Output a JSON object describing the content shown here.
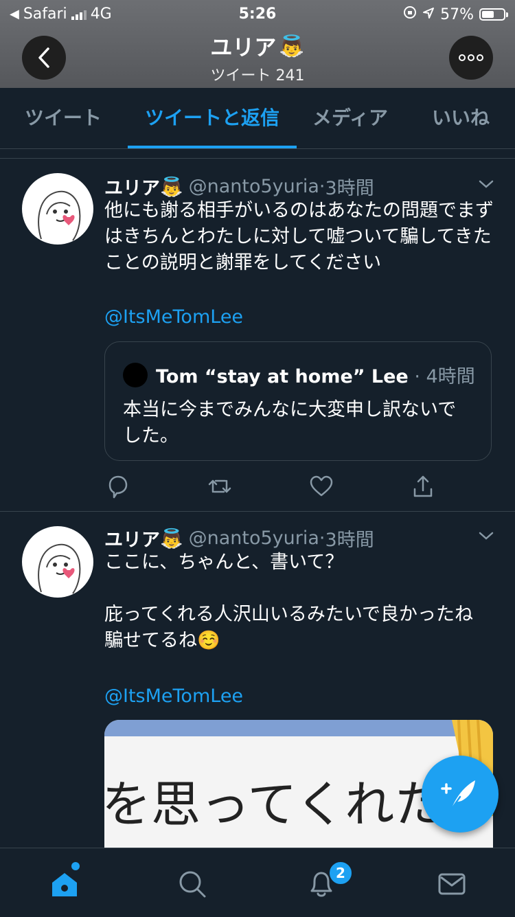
{
  "status_bar": {
    "back_app": "Safari",
    "network": "4G",
    "time": "5:26",
    "battery_percent_label": "57%",
    "battery_level": 0.57
  },
  "profile_header": {
    "name": "ユリア",
    "name_emoji": "👼",
    "tweet_count_label": "ツイート 241"
  },
  "tabs": [
    {
      "label": "ツイート",
      "active": false
    },
    {
      "label": "ツイートと返信",
      "active": true
    },
    {
      "label": "メディア",
      "active": false
    },
    {
      "label": "いいね",
      "active": false
    }
  ],
  "tweets": [
    {
      "author": "ユリア",
      "author_emoji": "👼",
      "handle": "@nanto5yuria",
      "time": "3時間",
      "text": "他にも謝る相手がいるのはあなたの問題でまずはきちんとわたしに対して嘘ついて騙してきたことの説明と謝罪をしてください",
      "mention": "@ItsMeTomLee",
      "quote": {
        "author": "Tom “stay at home” Lee",
        "time": "4時間",
        "text": "本当に今までみんなに大変申し訳ないでした。"
      }
    },
    {
      "author": "ユリア",
      "author_emoji": "👼",
      "handle": "@nanto5yuria",
      "time": "3時間",
      "text": "ここに、ちゃんと、書いて？\n\n庇ってくれる人沢山いるみたいで良かったね\n騙せてるね☺️",
      "mention": "@ItsMeTomLee",
      "media_text": "を思ってくれた"
    }
  ],
  "bottom_nav": {
    "notifications_badge": "2"
  },
  "colors": {
    "background": "#15202b",
    "accent": "#1da1f2",
    "secondary_text": "#8899a6",
    "divider": "#38444d"
  }
}
